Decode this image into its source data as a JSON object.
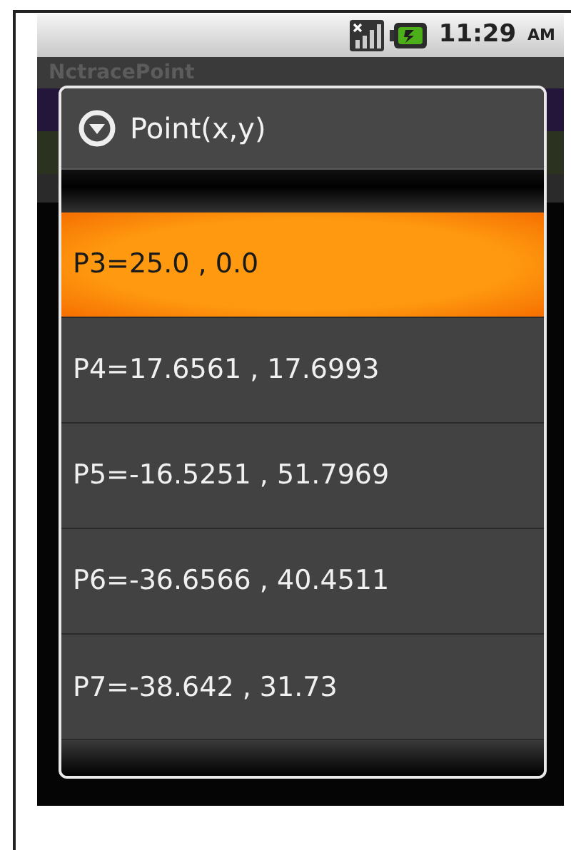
{
  "status_bar": {
    "time": "11:29",
    "meridiem": "AM"
  },
  "app": {
    "title": "NctracePoint"
  },
  "dialog": {
    "title": "Point(x,y)",
    "items": [
      {
        "label": "P3=25.0 , 0.0",
        "selected": true
      },
      {
        "label": "P4=17.6561 , 17.6993",
        "selected": false
      },
      {
        "label": "P5=-16.5251 , 51.7969",
        "selected": false
      },
      {
        "label": "P6=-36.6566 , 40.4511",
        "selected": false
      },
      {
        "label": "P7=-38.642 , 31.73",
        "selected": false
      }
    ]
  }
}
